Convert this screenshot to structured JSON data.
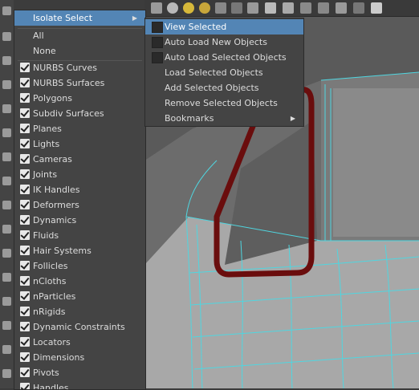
{
  "menu": {
    "header": "Isolate Select",
    "plain_items": [
      "All",
      "None"
    ],
    "items": [
      {
        "label": "NURBS Curves",
        "checked": true
      },
      {
        "label": "NURBS Surfaces",
        "checked": true
      },
      {
        "label": "Polygons",
        "checked": true
      },
      {
        "label": "Subdiv Surfaces",
        "checked": true
      },
      {
        "label": "Planes",
        "checked": true
      },
      {
        "label": "Lights",
        "checked": true
      },
      {
        "label": "Cameras",
        "checked": true
      },
      {
        "label": "Joints",
        "checked": true
      },
      {
        "label": "IK Handles",
        "checked": true
      },
      {
        "label": "Deformers",
        "checked": true
      },
      {
        "label": "Dynamics",
        "checked": true
      },
      {
        "label": "Fluids",
        "checked": true
      },
      {
        "label": "Hair Systems",
        "checked": true
      },
      {
        "label": "Follicles",
        "checked": true
      },
      {
        "label": "nCloths",
        "checked": true
      },
      {
        "label": "nParticles",
        "checked": true
      },
      {
        "label": "nRigids",
        "checked": true
      },
      {
        "label": "Dynamic Constraints",
        "checked": true
      },
      {
        "label": "Locators",
        "checked": true
      },
      {
        "label": "Dimensions",
        "checked": true
      },
      {
        "label": "Pivots",
        "checked": true
      },
      {
        "label": "Handles",
        "checked": true
      }
    ]
  },
  "submenu": {
    "items": [
      {
        "label": "View Selected",
        "checkbox": true,
        "highlighted": true
      },
      {
        "label": "Auto Load New Objects",
        "checkbox": true
      },
      {
        "label": "Auto Load Selected Objects",
        "checkbox": true
      },
      {
        "label": "Load Selected Objects",
        "checkbox": false
      },
      {
        "label": "Add Selected Objects",
        "checkbox": false
      },
      {
        "label": "Remove Selected Objects",
        "checkbox": false
      },
      {
        "label": "Bookmarks",
        "checkbox": false,
        "submenu": true
      }
    ]
  },
  "colors": {
    "highlight": "#5385b5",
    "menu_bg": "#444444",
    "wire": "#4fd6e0",
    "outline": "#6a0d0d"
  }
}
